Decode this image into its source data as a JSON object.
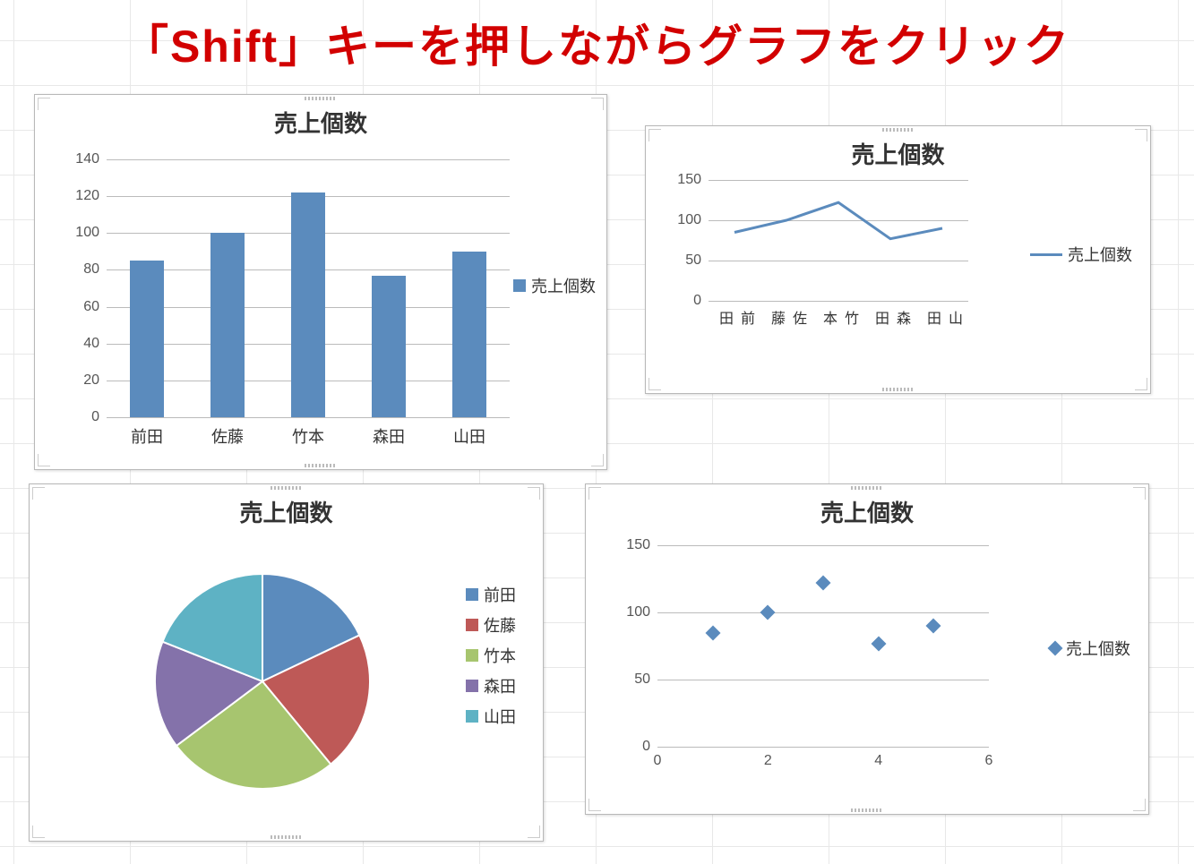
{
  "headline": "「Shift」キーを押しながらグラフをクリック",
  "chart_data": [
    {
      "id": "bar",
      "type": "bar",
      "title": "売上個数",
      "categories": [
        "前田",
        "佐藤",
        "竹本",
        "森田",
        "山田"
      ],
      "values": [
        85,
        100,
        122,
        77,
        90
      ],
      "legend": "売上個数",
      "yticks": [
        0,
        20,
        40,
        60,
        80,
        100,
        120,
        140
      ],
      "ylim": [
        0,
        140
      ],
      "color": "#5b8bbd"
    },
    {
      "id": "line",
      "type": "line",
      "title": "売上個数",
      "categories": [
        "前田",
        "佐藤",
        "竹本",
        "森田",
        "山田"
      ],
      "values": [
        85,
        100,
        122,
        77,
        90
      ],
      "legend": "売上個数",
      "yticks": [
        0,
        50,
        100,
        150
      ],
      "ylim": [
        0,
        150
      ],
      "color": "#5b8bbd"
    },
    {
      "id": "pie",
      "type": "pie",
      "title": "売上個数",
      "categories": [
        "前田",
        "佐藤",
        "竹本",
        "森田",
        "山田"
      ],
      "values": [
        85,
        100,
        122,
        77,
        90
      ],
      "colors": [
        "#5b8bbd",
        "#be5957",
        "#a7c56f",
        "#8472aa",
        "#5eb2c4"
      ]
    },
    {
      "id": "scatter",
      "type": "scatter",
      "title": "売上個数",
      "x": [
        1,
        2,
        3,
        4,
        5
      ],
      "y": [
        85,
        100,
        122,
        77,
        90
      ],
      "legend": "売上個数",
      "xticks": [
        0,
        2,
        4,
        6
      ],
      "yticks": [
        0,
        50,
        100,
        150
      ],
      "xlim": [
        0,
        6
      ],
      "ylim": [
        0,
        150
      ],
      "color": "#5b8bbd"
    }
  ]
}
